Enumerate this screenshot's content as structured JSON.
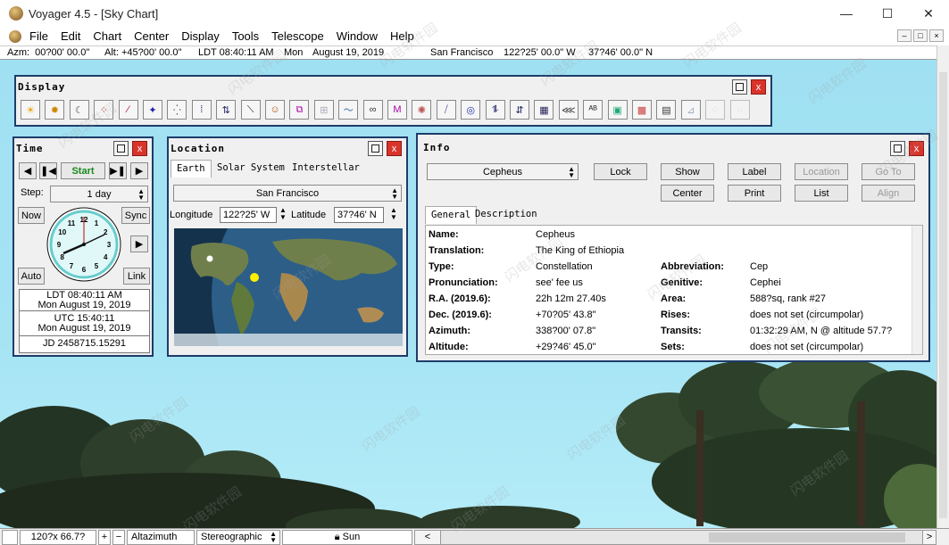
{
  "window": {
    "title": "Voyager 4.5 - [Sky Chart]"
  },
  "menu": [
    "File",
    "Edit",
    "Chart",
    "Center",
    "Display",
    "Tools",
    "Telescope",
    "Window",
    "Help"
  ],
  "status": {
    "azm": "Azm:  00?00' 00.0\"",
    "alt": "Alt: +45?00' 00.0\"",
    "ldt": "LDT 08:40:11 AM",
    "day": "Mon",
    "date": "August 19, 2019",
    "place": "San Francisco",
    "lon": "122?25' 00.0\" W",
    "lat": "37?46' 00.0\" N"
  },
  "display_panel": {
    "title": "Display",
    "icons": [
      "sun-icon",
      "planets-icon",
      "moon-icon",
      "asteroids-icon",
      "comets-icon",
      "satellites-icon",
      "stars-icon",
      "double-stars-icon",
      "variable-stars-icon",
      "constellation-lines-icon",
      "constellation-figures-icon",
      "constellation-boundaries-icon",
      "deep-sky-icon",
      "galaxies-icon",
      "clusters-icon",
      "messier-icon",
      "nebulae-icon",
      "milky-way-icon",
      "grid-icon-1",
      "grid-icon-2",
      "grid-icon-3",
      "horizon-grid-icon",
      "ecliptic-icon",
      "labels-icon",
      "landscape-icon",
      "colors-icon",
      "film-icon",
      "filters-icon",
      "circle-icon-1",
      "circle-icon-2"
    ]
  },
  "time_panel": {
    "title": "Time",
    "start": "Start",
    "step_label": "Step:",
    "step_value": "1 day",
    "now": "Now",
    "sync": "Sync",
    "auto": "Auto",
    "link": "Link",
    "ldt_line1": "LDT 08:40:11 AM",
    "ldt_line2": "Mon August 19, 2019",
    "utc_line1": "UTC 15:40:11",
    "utc_line2": "Mon August 19, 2019",
    "jd": "JD 2458715.15291",
    "clock_hours": [
      "12",
      "1",
      "2",
      "3",
      "4",
      "5",
      "6",
      "7",
      "8",
      "9",
      "10",
      "11"
    ]
  },
  "location_panel": {
    "title": "Location",
    "tabs": [
      "Earth",
      "Solar System",
      "Interstellar"
    ],
    "place": "San Francisco",
    "lon_label": "Longitude",
    "lon_value": "122?25' W",
    "lat_label": "Latitude",
    "lat_value": "37?46' N"
  },
  "info_panel": {
    "title": "Info",
    "object": "Cepheus",
    "buttons": {
      "lock": "Lock",
      "show": "Show",
      "label": "Label",
      "location": "Location",
      "goto": "Go To",
      "center": "Center",
      "print": "Print",
      "list": "List",
      "align": "Align"
    },
    "tabs": [
      "General",
      "Description"
    ],
    "left_rows": [
      {
        "k": "Name:",
        "v": "Cepheus"
      },
      {
        "k": "Translation:",
        "v": "The King of Ethiopia"
      },
      {
        "k": "Type:",
        "v": "Constellation"
      },
      {
        "k": "Pronunciation:",
        "v": "see' fee us"
      },
      {
        "k": "R.A. (2019.6):",
        "v": "22h 12m 27.40s"
      },
      {
        "k": "Dec. (2019.6):",
        "v": "+70?05' 43.8\""
      },
      {
        "k": "Azimuth:",
        "v": "338?00' 07.8\""
      },
      {
        "k": "Altitude:",
        "v": "+29?46' 45.0\""
      }
    ],
    "right_rows": [
      {
        "k": "Abbreviation:",
        "v": "Cep"
      },
      {
        "k": "Genitive:",
        "v": "Cephei"
      },
      {
        "k": "Area:",
        "v": "588?sq, rank #27"
      },
      {
        "k": "Rises:",
        "v": "does not set (circumpolar)"
      },
      {
        "k": "Transits:",
        "v": "01:32:29 AM, N @ altitude 57.7?"
      },
      {
        "k": "Sets:",
        "v": "does not set (circumpolar)"
      }
    ]
  },
  "bottom": {
    "fov": "120?x 66.7?",
    "plus": "+",
    "minus": "−",
    "coords": "Altazimuth",
    "projection": "Stereographic",
    "sun": "Sun"
  },
  "watermark": "闪电软件园"
}
